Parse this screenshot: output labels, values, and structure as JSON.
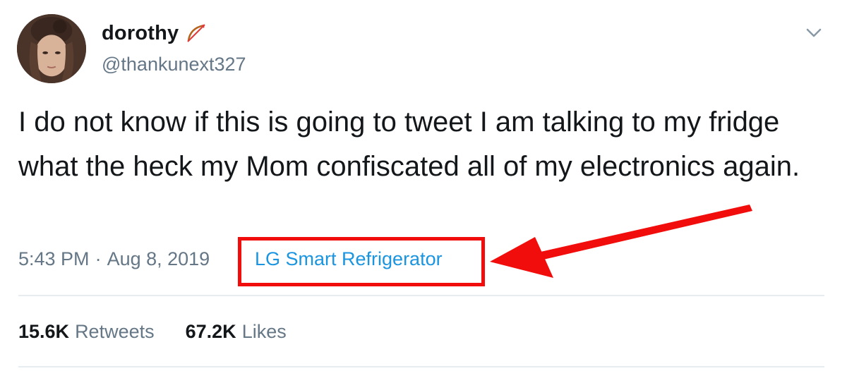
{
  "user": {
    "display_name": "dorothy",
    "handle": "@thankunext327",
    "name_emoji": "bow-and-arrow-icon"
  },
  "tweet": {
    "text": "I do not know if this is going to tweet I am talking to my fridge what the heck my Mom confiscated all of my electronics again.",
    "time": "5:43 PM",
    "separator": "·",
    "date": "Aug 8, 2019",
    "source": "LG Smart Refrigerator"
  },
  "stats": {
    "retweets_count": "15.6K",
    "retweets_label": "Retweets",
    "likes_count": "67.2K",
    "likes_label": "Likes"
  },
  "colors": {
    "link": "#1b95e0",
    "muted": "#657786",
    "highlight": "#f10d0b",
    "divider": "#e6ecf0"
  },
  "icons": {
    "menu": "chevron-down-icon"
  }
}
